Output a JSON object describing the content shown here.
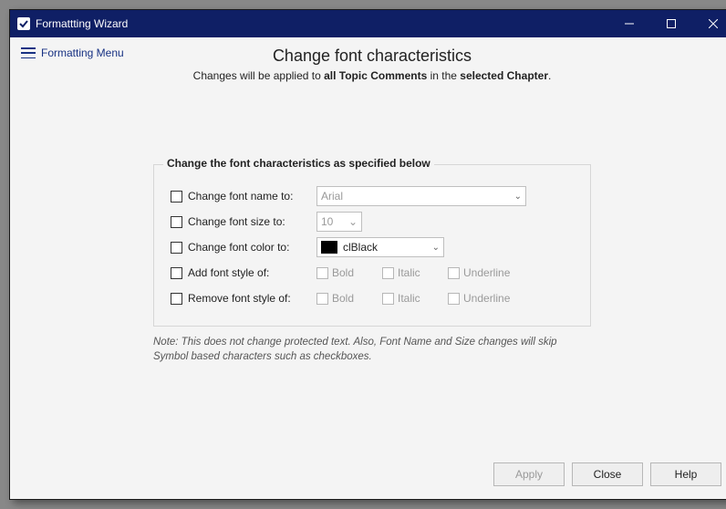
{
  "window": {
    "title": "Formattting Wizard"
  },
  "menu_link": "Formatting Menu",
  "header": {
    "title": "Change font characteristics",
    "sub_pre": "Changes will be applied to ",
    "sub_b1": "all Topic Comments",
    "sub_mid": " in the ",
    "sub_b2": "selected Chapter",
    "sub_post": "."
  },
  "group": {
    "title": "Change the font characteristics as specified below",
    "rows": {
      "name": {
        "label": "Change font name to:",
        "value": "Arial"
      },
      "size": {
        "label": "Change font size to:",
        "value": "10"
      },
      "color": {
        "label": "Change font color to:",
        "value": "clBlack",
        "swatch": "#000000"
      },
      "add": {
        "label": "Add font style of:"
      },
      "remove": {
        "label": "Remove font style of:"
      }
    },
    "styles": {
      "bold": "Bold",
      "italic": "Italic",
      "underline": "Underline"
    }
  },
  "note": "Note: This does not change protected text.  Also, Font Name and Size changes will skip Symbol based characters such as checkboxes.",
  "buttons": {
    "apply": "Apply",
    "close": "Close",
    "help": "Help"
  }
}
